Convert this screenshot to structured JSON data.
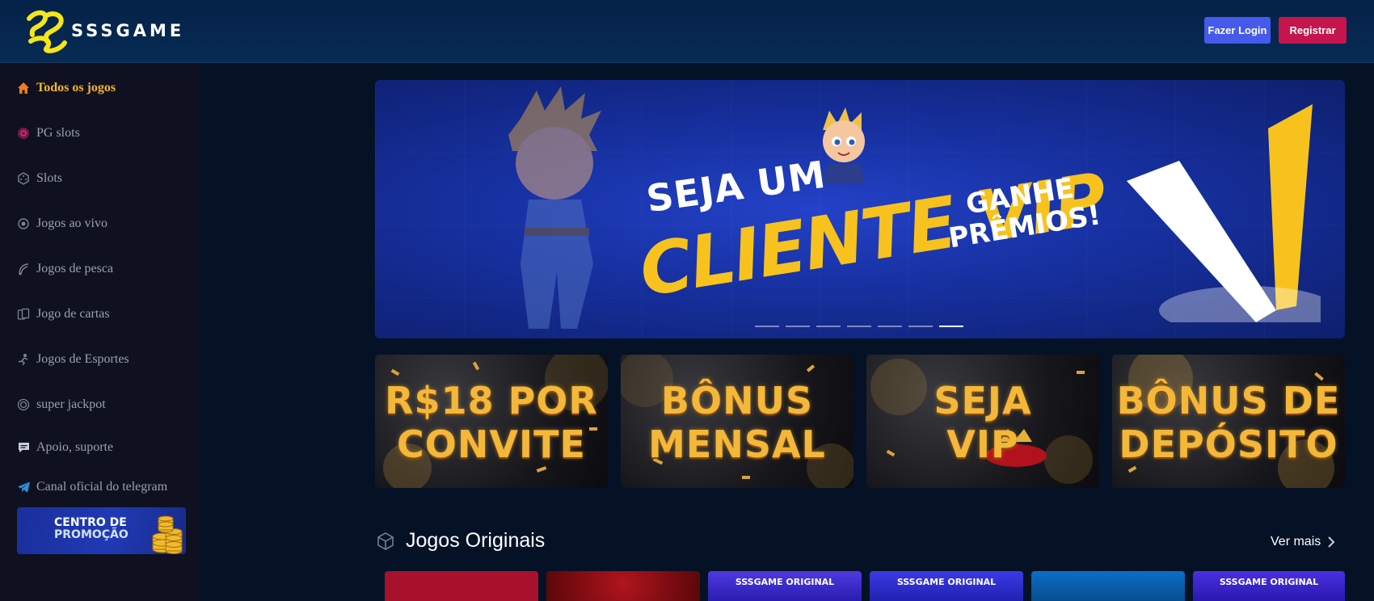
{
  "brand": {
    "name": "SSSGAME"
  },
  "header": {
    "login_label": "Fazer Login",
    "register_label": "Registrar"
  },
  "sidebar": {
    "items": [
      {
        "label": "Todos os jogos",
        "icon": "home-icon",
        "active": true
      },
      {
        "label": "PG slots",
        "icon": "pg-icon"
      },
      {
        "label": "Slots",
        "icon": "dice-icon"
      },
      {
        "label": "Jogos ao vivo",
        "icon": "live-icon"
      },
      {
        "label": "Jogos de pesca",
        "icon": "fish-icon"
      },
      {
        "label": "Jogo de cartas",
        "icon": "cards-icon"
      },
      {
        "label": "Jogos de Esportes",
        "icon": "sports-icon"
      },
      {
        "label": "super jackpot",
        "icon": "jackpot-icon"
      },
      {
        "label": "Apoio, suporte",
        "icon": "chat-icon"
      },
      {
        "label": "Canal oficial do telegram",
        "icon": "telegram-icon"
      }
    ],
    "promo": {
      "line1": "CENTRO DE",
      "line2": "PROMOÇÃO"
    }
  },
  "hero": {
    "line1": "SEJA UM",
    "line2": "CLIENTE VIP",
    "line3a": "GANHE",
    "line3b": "PRÊMIOS!",
    "slides_count": 7,
    "active_slide": 7
  },
  "promo_cards": [
    {
      "line1": "R$18 POR",
      "line2": "CONVITE"
    },
    {
      "line1": "BÔNUS",
      "line2": "MENSAL"
    },
    {
      "line1": "SEJA",
      "line2": "VIP"
    },
    {
      "line1": "BÔNUS DE",
      "line2": "DEPÓSITO"
    }
  ],
  "section": {
    "title": "Jogos Originais",
    "see_more": "Ver mais"
  },
  "games": [
    {
      "label": "",
      "bg": "#a8112c"
    },
    {
      "label": "",
      "bg": "#7a0c10"
    },
    {
      "label": "SSSGAME ORIGINAL",
      "bg": "#3b2ad6"
    },
    {
      "label": "SSSGAME ORIGINAL",
      "bg": "#2730d8"
    },
    {
      "label": "",
      "bg": "#0a63b8"
    },
    {
      "label": "SSSGAME ORIGINAL",
      "bg": "#3224d6"
    }
  ],
  "colors": {
    "accent": "#f5b42b",
    "login": "#4559ea",
    "register": "#c5154d",
    "bg": "#051226"
  }
}
